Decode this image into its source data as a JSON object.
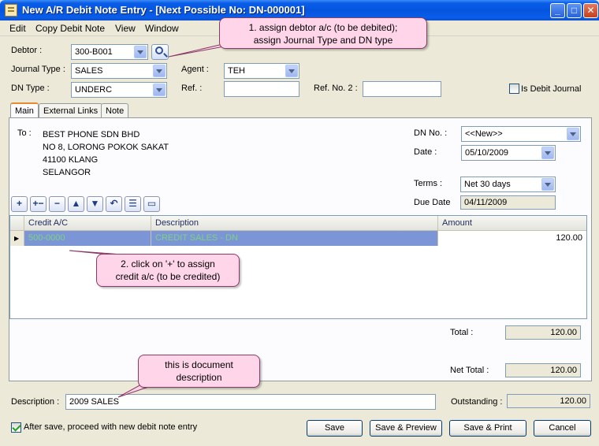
{
  "window": {
    "title": "New A/R Debit Note Entry - [Next Possible No: DN-000001]",
    "min_glyph": "_",
    "max_glyph": "□",
    "close_glyph": "✕"
  },
  "menu": [
    "Edit",
    "Copy Debit Note",
    "View",
    "Window"
  ],
  "header": {
    "debtor_label": "Debtor :",
    "debtor_value": "300-B001",
    "journal_type_label": "Journal Type :",
    "journal_type_value": "SALES",
    "agent_label": "Agent :",
    "agent_value": "TEH",
    "dn_type_label": "DN Type :",
    "dn_type_value": "UNDERC",
    "ref_label": "Ref. :",
    "ref_value": "",
    "ref2_label": "Ref. No. 2 :",
    "ref2_value": "",
    "is_debit_journal_label": "Is Debit Journal",
    "is_debit_journal_checked": false
  },
  "tabs": [
    "Main",
    "External Links",
    "Note"
  ],
  "main": {
    "to_label": "To :",
    "address": [
      "BEST PHONE SDN BHD",
      "NO 8, LORONG POKOK SAKAT",
      "41100 KLANG",
      "SELANGOR"
    ],
    "dn_no_label": "DN No. :",
    "dn_no_value": "<<New>>",
    "date_label": "Date :",
    "date_value": "05/10/2009",
    "terms_label": "Terms :",
    "terms_value": "Net 30 days",
    "due_date_label": "Due Date",
    "due_date_value": "04/11/2009"
  },
  "toolbar_icons": [
    "add-icon",
    "insert-icon",
    "delete-icon",
    "move-up-icon",
    "move-down-icon",
    "undo-icon",
    "list-icon",
    "detail-icon"
  ],
  "grid": {
    "columns": [
      "Credit A/C",
      "Description",
      "Amount"
    ],
    "rows": [
      {
        "credit_ac": "500-0000",
        "description": "CREDIT SALES - DN",
        "amount": "120.00"
      }
    ]
  },
  "totals": {
    "total_label": "Total :",
    "total_value": "120.00",
    "net_total_label": "Net Total :",
    "net_total_value": "120.00",
    "outstanding_label": "Outstanding :",
    "outstanding_value": "120.00"
  },
  "description": {
    "label": "Description :",
    "value": "2009 SALES"
  },
  "footer": {
    "after_save_label": "After save, proceed with new debit note entry",
    "after_save_checked": true,
    "save": "Save",
    "save_preview": "Save & Preview",
    "save_print": "Save & Print",
    "cancel": "Cancel"
  },
  "callouts": {
    "debtor": [
      "1. assign debtor a/c (to be debited);",
      "assign Journal Type and DN type"
    ],
    "credit": [
      "2. click on '+' to assign",
      "credit a/c (to be credited)"
    ],
    "description": [
      "this is document",
      "description"
    ]
  },
  "colors": {
    "selected_row": "#7b95d6",
    "selected_text": "#7dd37d",
    "callout_fill": "#ffd6e9"
  }
}
